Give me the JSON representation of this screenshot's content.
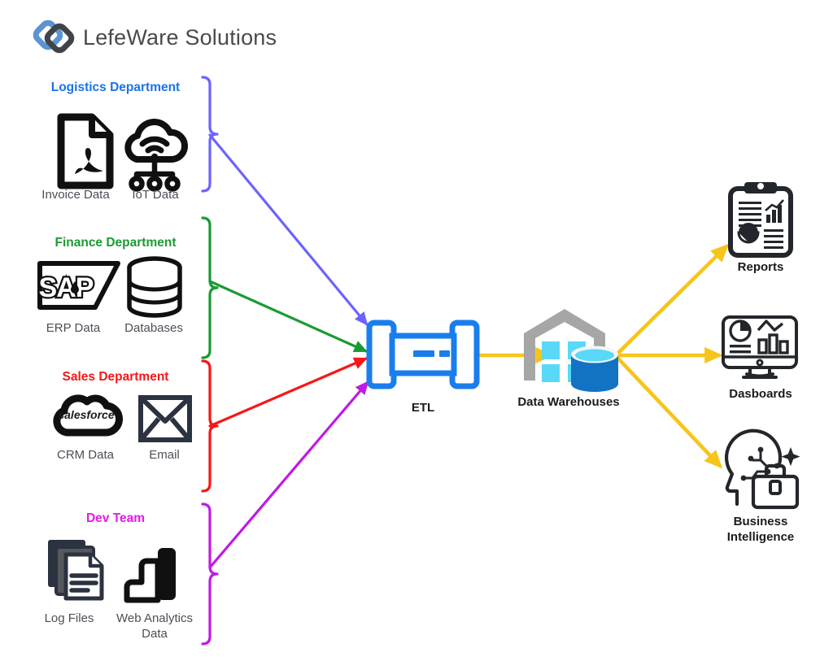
{
  "brand": {
    "name": "LefeWare Solutions",
    "logo_icon": "interlocking-diamonds-logo",
    "colors": {
      "primary": "#5b93d3",
      "secondary": "#3f4448"
    }
  },
  "diagram": {
    "type": "data-pipeline-flow",
    "colors": {
      "logistics": "#1a73e8",
      "logistics_arrow": "#6c63ff",
      "finance": "#1a9b32",
      "sales": "#f91616",
      "dev": "#e619e6",
      "etl": "#1a7ded",
      "flow_out": "#f7c41a",
      "warehouse_building": "#a6a6a6",
      "warehouse_window": "#5ad8f7",
      "warehouse_cylinder": "#1273c4",
      "icon_dark": "#23262b",
      "label_text": "#4b4f56"
    },
    "sources": [
      {
        "id": "logistics",
        "title": "Logistics Department",
        "color": "#1a73e8",
        "arrow_color": "#6c63ff",
        "items": [
          {
            "label": "Invoice Data",
            "icon": "pdf-document-icon"
          },
          {
            "label": "IoT Data",
            "icon": "iot-cloud-icon"
          }
        ]
      },
      {
        "id": "finance",
        "title": "Finance Department",
        "color": "#1a9b32",
        "arrow_color": "#1a9b32",
        "items": [
          {
            "label": "ERP Data",
            "icon": "sap-logo-icon"
          },
          {
            "label": "Databases",
            "icon": "database-cylinder-icon"
          }
        ]
      },
      {
        "id": "sales",
        "title": "Sales Department",
        "color": "#f91616",
        "arrow_color": "#f91616",
        "items": [
          {
            "label": "CRM Data",
            "icon": "salesforce-cloud-icon"
          },
          {
            "label": "Email",
            "icon": "envelope-icon"
          }
        ]
      },
      {
        "id": "dev",
        "title": "Dev Team",
        "color": "#e619e6",
        "arrow_color": "#c01ae6",
        "items": [
          {
            "label": "Log Files",
            "icon": "document-stack-icon"
          },
          {
            "label": "Web Analytics\nData",
            "icon": "power-bi-bars-icon"
          }
        ]
      }
    ],
    "process": {
      "label": "ETL",
      "icon": "etl-pipe-filter-icon",
      "color": "#1a7ded"
    },
    "storage": {
      "label": "Data Warehouses",
      "icon": "warehouse-with-database-icon"
    },
    "outputs": [
      {
        "label": "Reports",
        "icon": "clipboard-report-icon"
      },
      {
        "label": "Dasboards",
        "icon": "monitor-dashboard-icon"
      },
      {
        "label": "Business\nIntelligence",
        "icon": "ai-head-briefcase-icon"
      }
    ]
  }
}
